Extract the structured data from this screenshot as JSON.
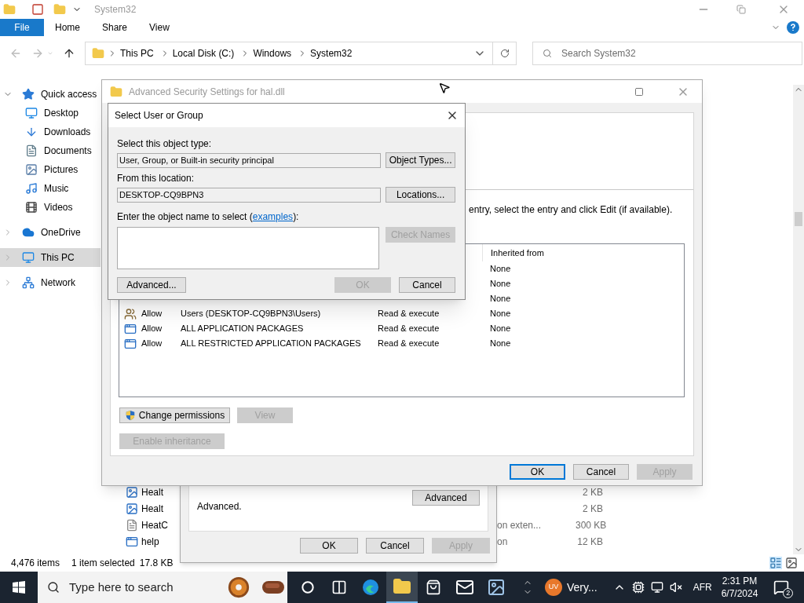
{
  "explorer": {
    "title": "System32",
    "ribbon": {
      "file_tab": "File",
      "tabs": [
        "Home",
        "Share",
        "View"
      ]
    },
    "breadcrumbs": [
      "This PC",
      "Local Disk (C:)",
      "Windows",
      "System32"
    ],
    "search": {
      "placeholder": "Search System32"
    },
    "nav": [
      {
        "label": "Quick access",
        "kind": "star",
        "expanded": true,
        "selected": false,
        "children": [
          {
            "label": "Desktop",
            "kind": "desktop",
            "selected": false
          },
          {
            "label": "Downloads",
            "kind": "download",
            "selected": false
          },
          {
            "label": "Documents",
            "kind": "documents",
            "selected": false
          },
          {
            "label": "Pictures",
            "kind": "pictures",
            "selected": false
          },
          {
            "label": "Music",
            "kind": "music",
            "selected": false
          },
          {
            "label": "Videos",
            "kind": "videos",
            "selected": false
          }
        ]
      },
      {
        "label": "OneDrive",
        "kind": "cloud",
        "expanded": false,
        "selected": false
      },
      {
        "label": "This PC",
        "kind": "computer",
        "expanded": false,
        "selected": true
      },
      {
        "label": "Network",
        "kind": "network",
        "expanded": false,
        "selected": false
      }
    ],
    "files": [
      {
        "name": "Healt",
        "size": "2 KB",
        "kind": "image"
      },
      {
        "name": "Healt",
        "size": "2 KB",
        "kind": "image"
      },
      {
        "name": "HeatC",
        "type": "on exten...",
        "size": "300 KB",
        "kind": "dll"
      },
      {
        "name": "help",
        "type": "on",
        "size": "12 KB",
        "kind": "app"
      }
    ],
    "status": {
      "count": "4,476 items",
      "selection": "1 item selected",
      "size": "17.8 KB"
    }
  },
  "properties": {
    "text": "Advanced.",
    "advanced_button": "Advanced",
    "buttons": [
      {
        "label": "OK",
        "disabled": false
      },
      {
        "label": "Cancel",
        "disabled": false
      },
      {
        "label": "Apply",
        "disabled": true
      }
    ]
  },
  "advanced_security": {
    "title": "Advanced Security Settings for hal.dll",
    "hint": "entry, select the entry and click Edit (if available).",
    "column": "Inherited from",
    "entries": [
      {
        "inherited": "None"
      },
      {
        "inherited": "None"
      },
      {
        "inherited": "None"
      },
      {
        "kind": "users",
        "type": "Allow",
        "principal": "Users (DESKTOP-CQ9BPN3\\Users)",
        "access": "Read & execute",
        "inherited": "None"
      },
      {
        "kind": "package",
        "type": "Allow",
        "principal": "ALL APPLICATION PACKAGES",
        "access": "Read & execute",
        "inherited": "None"
      },
      {
        "kind": "package",
        "type": "Allow",
        "principal": "ALL RESTRICTED APPLICATION PACKAGES",
        "access": "Read & execute",
        "inherited": "None"
      }
    ],
    "change_button": {
      "label": "Change permissions",
      "disabled": false
    },
    "view_button": {
      "label": "View",
      "disabled": true
    },
    "inheritance_button": {
      "label": "Enable inheritance",
      "disabled": true
    },
    "buttons": [
      {
        "label": "OK",
        "disabled": false,
        "default": true
      },
      {
        "label": "Cancel",
        "disabled": false,
        "default": false
      },
      {
        "label": "Apply",
        "disabled": true,
        "default": false
      }
    ]
  },
  "select_dialog": {
    "title": "Select User or Group",
    "type_label": "Select this object type:",
    "type_value": "User, Group, or Built-in security principal",
    "type_button": "Object Types...",
    "location_label": "From this location:",
    "location_value": "DESKTOP-CQ9BPN3",
    "location_button": "Locations...",
    "name_label_start": "Enter the object name to select (",
    "name_link": "examples",
    "name_label_end": "):",
    "check_button": {
      "label": "Check Names",
      "disabled": true
    },
    "advanced_button": {
      "label": "Advanced...",
      "disabled": false
    },
    "ok_button": {
      "label": "OK",
      "disabled": true
    },
    "cancel_button": {
      "label": "Cancel",
      "disabled": false
    }
  },
  "taskbar": {
    "search_placeholder": "Type here to search",
    "apps": [
      {
        "kind": "cortana",
        "active": false
      },
      {
        "kind": "taskview",
        "active": false
      },
      {
        "kind": "edge",
        "active": false
      },
      {
        "kind": "explorer",
        "active": true
      },
      {
        "kind": "store",
        "active": false
      },
      {
        "kind": "mail",
        "active": false
      },
      {
        "kind": "photos",
        "active": false
      }
    ],
    "weather_badge": "UV",
    "weather_text": "Very...",
    "language": "AFR",
    "time": "2:31 PM",
    "date": "6/7/2024",
    "notifications": "2"
  }
}
